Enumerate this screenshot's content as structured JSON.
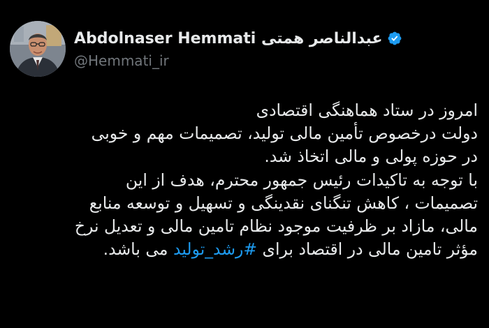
{
  "tweet": {
    "author": {
      "display_name": "Abdolnaser Hemmati عبدالناصر همتی",
      "handle": "@Hemmati_ir",
      "verified_icon": "verified-badge-icon",
      "verified_color": "#1d9bf0"
    },
    "lines": [
      {
        "text": "امروز در ستاد هماهنگی اقتصادی"
      },
      {
        "text": "دولت درخصوص تأمین مالی تولید، تصمیمات مهم و خوبی"
      },
      {
        "text": "در حوزه پولی و مالی اتخاذ شد."
      },
      {
        "text": "با توجه به تاکیدات رئیس جمهور محترم، هدف از این"
      },
      {
        "text": "تصمیمات ، کاهش تنگنای نقدینگی و تسهیل و توسعه منابع"
      },
      {
        "text": "مالی، مازاد بر ظرفیت موجود نظام تامین مالی و تعدیل نرخ"
      },
      {
        "before": "مؤثر تامین مالی در اقتصاد برای ",
        "hashtag": "#رشد_تولید",
        "after": " می باشد."
      }
    ],
    "hashtag_color": "#1d9bf0"
  }
}
